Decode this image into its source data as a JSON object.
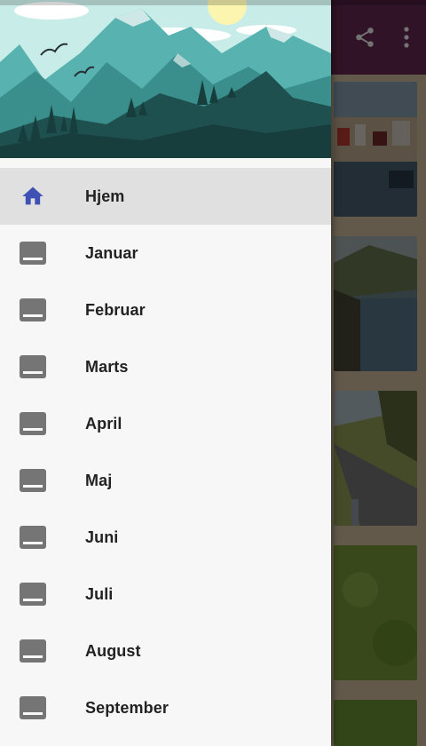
{
  "drawer": {
    "items": [
      {
        "label": "Hjem",
        "icon": "home-icon",
        "active": true
      },
      {
        "label": "Januar",
        "icon": "image-icon",
        "active": false
      },
      {
        "label": "Februar",
        "icon": "image-icon",
        "active": false
      },
      {
        "label": "Marts",
        "icon": "image-icon",
        "active": false
      },
      {
        "label": "April",
        "icon": "image-icon",
        "active": false
      },
      {
        "label": "Maj",
        "icon": "image-icon",
        "active": false
      },
      {
        "label": "Juni",
        "icon": "image-icon",
        "active": false
      },
      {
        "label": "Juli",
        "icon": "image-icon",
        "active": false
      },
      {
        "label": "August",
        "icon": "image-icon",
        "active": false
      },
      {
        "label": "September",
        "icon": "image-icon",
        "active": false
      }
    ]
  },
  "toolbar": {
    "actions": [
      {
        "icon": "share-icon"
      },
      {
        "icon": "overflow-menu-icon"
      }
    ]
  },
  "colors": {
    "toolbar": "#6a2a55",
    "active_icon": "#3f51b5",
    "inactive_icon": "#757575",
    "active_row": "#e0e0e0"
  }
}
